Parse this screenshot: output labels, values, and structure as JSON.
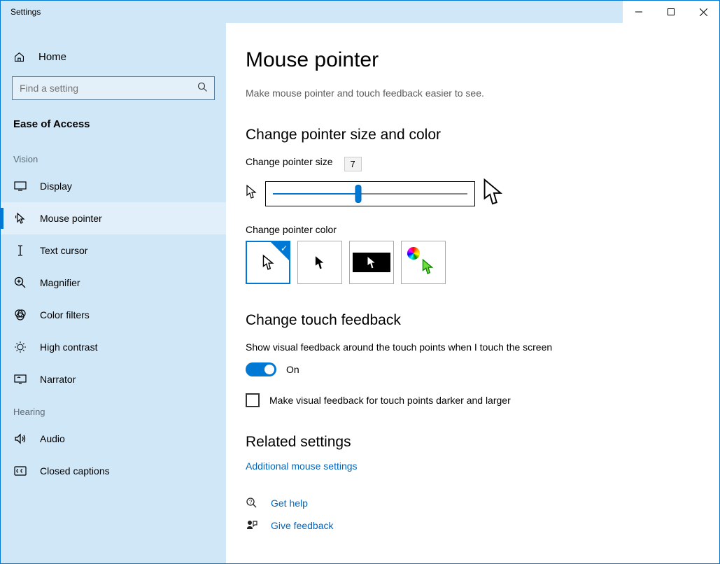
{
  "window": {
    "title": "Settings"
  },
  "sidebar": {
    "home": "Home",
    "search_placeholder": "Find a setting",
    "category": "Ease of Access",
    "groups": [
      {
        "label": "Vision",
        "items": [
          {
            "icon": "display-icon",
            "label": "Display"
          },
          {
            "icon": "mouse-pointer-icon",
            "label": "Mouse pointer",
            "selected": true
          },
          {
            "icon": "text-cursor-icon",
            "label": "Text cursor"
          },
          {
            "icon": "magnifier-icon",
            "label": "Magnifier"
          },
          {
            "icon": "color-filters-icon",
            "label": "Color filters"
          },
          {
            "icon": "high-contrast-icon",
            "label": "High contrast"
          },
          {
            "icon": "narrator-icon",
            "label": "Narrator"
          }
        ]
      },
      {
        "label": "Hearing",
        "items": [
          {
            "icon": "audio-icon",
            "label": "Audio"
          },
          {
            "icon": "closed-captions-icon",
            "label": "Closed captions"
          }
        ]
      }
    ]
  },
  "main": {
    "title": "Mouse pointer",
    "description": "Make mouse pointer and touch feedback easier to see.",
    "size_color_heading": "Change pointer size and color",
    "size_label": "Change pointer size",
    "size_value": "7",
    "size_percent": 44,
    "color_label": "Change pointer color",
    "color_options": [
      "white",
      "black",
      "inverted",
      "custom"
    ],
    "color_selected": 0,
    "touch_heading": "Change touch feedback",
    "touch_desc": "Show visual feedback around the touch points when I touch the screen",
    "toggle_state": "On",
    "checkbox_label": "Make visual feedback for touch points darker and larger",
    "related_heading": "Related settings",
    "related_link": "Additional mouse settings",
    "help_link": "Get help",
    "feedback_link": "Give feedback"
  }
}
